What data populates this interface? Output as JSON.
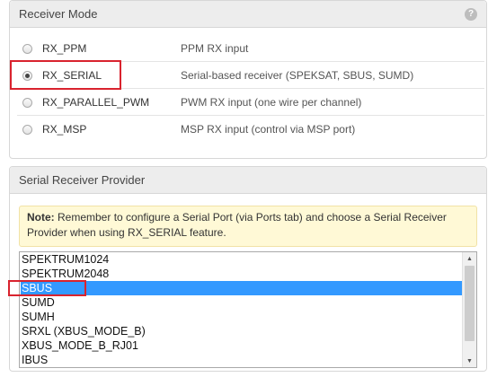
{
  "receiver_mode": {
    "title": "Receiver Mode",
    "help_icon": "?",
    "options": [
      {
        "label": "RX_PPM",
        "desc": "PPM RX input",
        "checked": false
      },
      {
        "label": "RX_SERIAL",
        "desc": "Serial-based receiver (SPEKSAT, SBUS, SUMD)",
        "checked": true
      },
      {
        "label": "RX_PARALLEL_PWM",
        "desc": "PWM RX input (one wire per channel)",
        "checked": false
      },
      {
        "label": "RX_MSP",
        "desc": "MSP RX input (control via MSP port)",
        "checked": false
      }
    ]
  },
  "serial_provider": {
    "title": "Serial Receiver Provider",
    "note_label": "Note:",
    "note_text": " Remember to configure a Serial Port (via Ports tab) and choose a Serial Receiver Provider when using RX_SERIAL feature.",
    "options": [
      "SPEKTRUM1024",
      "SPEKTRUM2048",
      "SBUS",
      "SUMD",
      "SUMH",
      "SRXL (XBUS_MODE_B)",
      "XBUS_MODE_B_RJ01",
      "IBUS"
    ],
    "selected": "SBUS",
    "scroll_up": "▲",
    "scroll_down": "▼"
  },
  "colors": {
    "highlight_box": "#d9232e",
    "selection": "#3399ff",
    "note_bg": "#fff9d6"
  }
}
